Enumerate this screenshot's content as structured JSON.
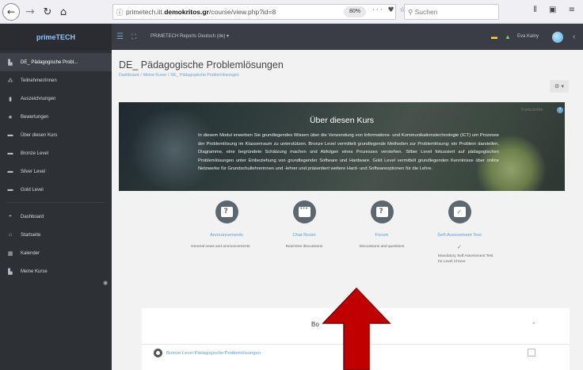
{
  "browser": {
    "back_icon": "arrow-left-icon",
    "url_prefix": "primetech.iit.",
    "url_domain": "demokritos.gr",
    "url_path": "/course/view.php?id=8",
    "zoom": "80%",
    "url_actions": "··· ♥ ☆",
    "search_placeholder": "Suchen"
  },
  "navbar": {
    "brand": "primeTECH",
    "site_name": "PRIMETECH Reports",
    "language": "Deutsch (de) ▾",
    "user_name": "Eva Kalny"
  },
  "sidebar": {
    "items": [
      {
        "label": "DE_ Pädagogische Probl...",
        "icon": "graduation-cap-icon",
        "glyph": "▙"
      },
      {
        "label": "Teilnehmer/innen",
        "icon": "users-icon",
        "glyph": "👥"
      },
      {
        "label": "Auszeichnungen",
        "icon": "badge-icon",
        "glyph": "▮"
      },
      {
        "label": "Bewertungen",
        "icon": "star-icon",
        "glyph": "★"
      },
      {
        "label": "Über diesen Kurs",
        "icon": "folder-icon",
        "glyph": "▬"
      },
      {
        "label": "Bronze Level",
        "icon": "folder-icon",
        "glyph": "▬"
      },
      {
        "label": "Silver Level",
        "icon": "folder-icon",
        "glyph": "▬"
      },
      {
        "label": "Gold Level",
        "icon": "folder-icon",
        "glyph": "▬"
      },
      {
        "label": "Dashboard",
        "icon": "dashboard-icon",
        "glyph": "◓"
      },
      {
        "label": "Startseite",
        "icon": "home-icon",
        "glyph": "⌂"
      },
      {
        "label": "Kalender",
        "icon": "calendar-icon",
        "glyph": "▦"
      },
      {
        "label": "Meine Kurse",
        "icon": "graduation-cap-icon",
        "glyph": "▙"
      }
    ]
  },
  "main": {
    "title": "DE_ Pädagogische Problemlösungen",
    "breadcrumb": [
      "Dashboard",
      "Meine Kurse",
      "DE_ Pädagogische Problemlösungen"
    ],
    "progress_label": "Fortschritte",
    "hero": {
      "title": "Über diesen Kurs",
      "text": "In diesem Modul erwerben Sie grundlegendes Wissen über die Verwendung von Informations- und Kommunikationstechnologie (ICT) um Prozesse der Problemlösung im Klassenraum zu unterstützen. Bronze Level vermittelt grundlegende Methoden zur Problemlösung: ein Problem darstellen, Diagramme, eine begründete Schätzung machen und Abfolgen eines Prozesses verstehen. Silber Level fokussiert auf pädagogischen Problemlösungen unter Einbeziehung von grundlegender Software und Hardware. Gold Level vermittelt grundlegenden Kenntnisse über online Netzwerke für Grundschullehrerinnen und -lehrer und präsentiert weitere Hard- und Softwareoptionen für die Lehre."
    },
    "activities": [
      {
        "title": "Announcements",
        "desc": "General news and announcements",
        "icon": "question-icon"
      },
      {
        "title": "Chat Room",
        "desc": "Real-time discussions",
        "icon": "chat-icon"
      },
      {
        "title": "Forum",
        "desc": "Discussions and questions",
        "icon": "question-icon"
      },
      {
        "title": "Self-Assessment Test",
        "desc": "Mandatory Self Assessment Test for Level Choice",
        "icon": "test-icon"
      }
    ],
    "section": {
      "title": "Bo",
      "item": "Bronze Level Pädagogische Problemlösungen"
    }
  },
  "colors": {
    "navbar": "#3a3d44",
    "sidebar": "#2d3035",
    "accent": "#5a9fd6",
    "arrow": "#c00000"
  }
}
